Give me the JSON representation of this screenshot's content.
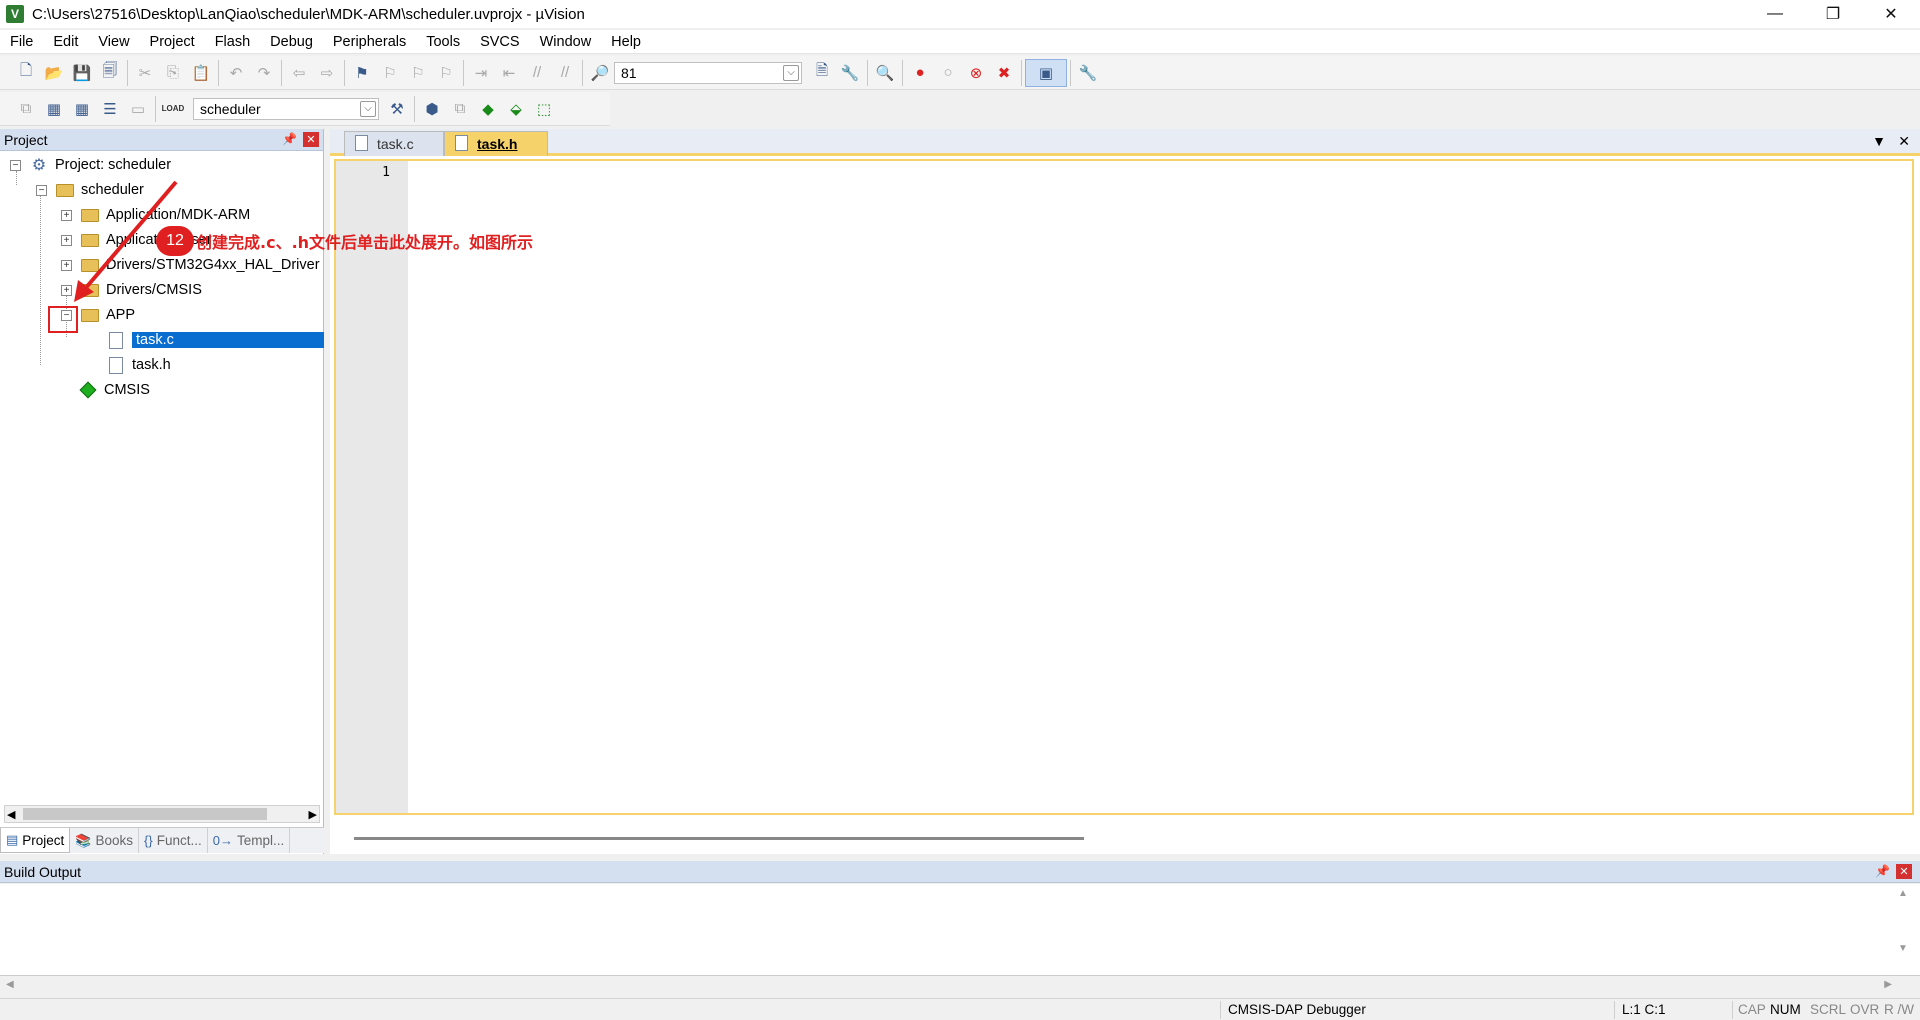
{
  "window": {
    "title": "C:\\Users\\27516\\Desktop\\LanQiao\\scheduler\\MDK-ARM\\scheduler.uvprojx - µVision",
    "app_icon": "V",
    "minimize": "—",
    "restore": "❐",
    "close": "✕"
  },
  "menu": [
    "File",
    "Edit",
    "View",
    "Project",
    "Flash",
    "Debug",
    "Peripherals",
    "Tools",
    "SVCS",
    "Window",
    "Help"
  ],
  "toolbar": {
    "find_value": "81",
    "target_name": "scheduler",
    "load_label": "LOAD"
  },
  "project_panel": {
    "title": "Project",
    "pin": "📌",
    "close": "✕",
    "tree": {
      "root": "Project: scheduler",
      "target": "scheduler",
      "groups": [
        {
          "label": "Application/MDK-ARM",
          "state": "+"
        },
        {
          "label": "Application/User",
          "state": "+"
        },
        {
          "label": "Drivers/STM32G4xx_HAL_Driver",
          "state": "+"
        },
        {
          "label": "Drivers/CMSIS",
          "state": "+"
        },
        {
          "label": "APP",
          "state": "−"
        }
      ],
      "files": [
        "task.c",
        "task.h"
      ],
      "cmsis": "CMSIS"
    },
    "tabs": [
      {
        "label": "Project",
        "icon": "▤"
      },
      {
        "label": "Books",
        "icon": "📚"
      },
      {
        "label": "Funct...",
        "icon": "{}"
      },
      {
        "label": "Templ...",
        "icon": "0→"
      }
    ]
  },
  "editor": {
    "tabs": [
      {
        "label": "task.c",
        "active": false
      },
      {
        "label": "task.h",
        "active": true
      }
    ],
    "line_number": "1",
    "accent_color": "#f5d26a"
  },
  "build_output": {
    "title": "Build Output"
  },
  "status": {
    "debugger": "CMSIS-DAP Debugger",
    "position": "L:1 C:1",
    "cap": "CAP",
    "num": "NUM",
    "scrl": "SCRL",
    "ovr": "OVR",
    "rw": "R /W"
  },
  "annotation": {
    "step": "12",
    "text": "创建完成.c、.h文件后单击此处展开。如图所示",
    "color": "#e02020"
  }
}
